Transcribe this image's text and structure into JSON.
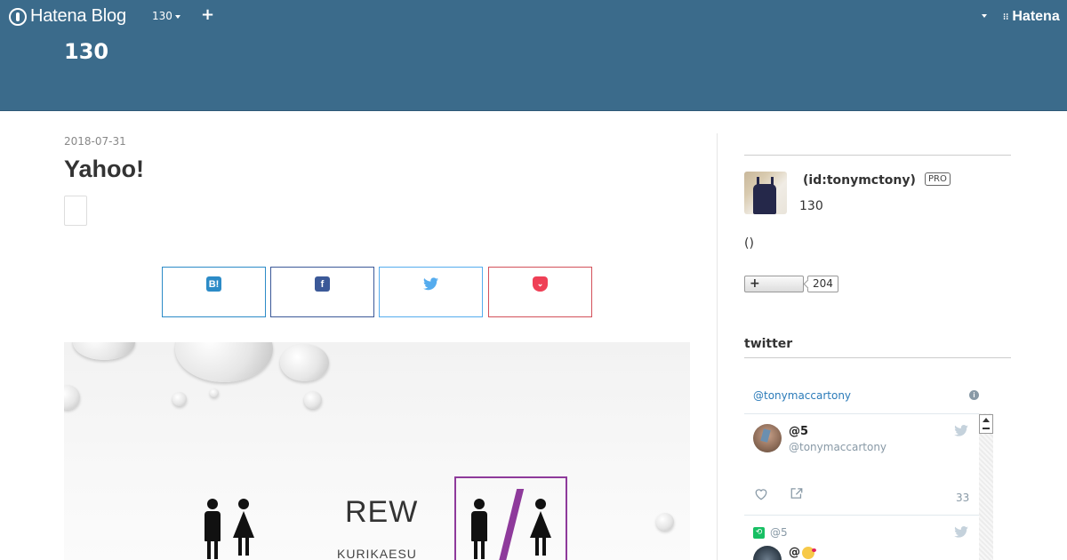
{
  "globalbar": {
    "brand": "Hatena Blog",
    "blog_selector": "130",
    "add_label": "+",
    "right_brand": "Hatena"
  },
  "blog": {
    "title": "130"
  },
  "entry": {
    "date": "2018-07-31",
    "title": "Yahoo!",
    "share": {
      "hatena_icon": "B!",
      "facebook_icon": "f",
      "twitter_icon": "🐦",
      "pocket_icon": "⌄"
    },
    "image": {
      "text_main": "REW",
      "text_sub": "KURIKAESU"
    }
  },
  "sidebar": {
    "profile": {
      "id_label": "(id:tonymctony)",
      "badge": "PRO",
      "name": "130",
      "paren_text": "()",
      "reader_button": "+",
      "reader_count": "204"
    },
    "twitter_section": {
      "title": "twitter",
      "widget_handle": "@tonymaccartony",
      "info_icon": "i",
      "tweets": [
        {
          "name": "@5",
          "screen_name": "@tonymaccartony",
          "count": "33"
        },
        {
          "retweet_label": "@5",
          "name": "@"
        }
      ]
    }
  },
  "colors": {
    "header_bg": "#3b6b8b",
    "hatena_blue": "#2c8bc7",
    "facebook": "#3b5998",
    "twitter": "#55acee",
    "pocket": "#d3505a",
    "accent_purple": "#8e3a9b"
  },
  "icons": {
    "logo": "hatena-logo-icon",
    "caret": "caret-down-icon",
    "bird": "twitter-bird-icon",
    "heart": "heart-icon",
    "share": "share-icon",
    "retweet": "retweet-icon"
  }
}
